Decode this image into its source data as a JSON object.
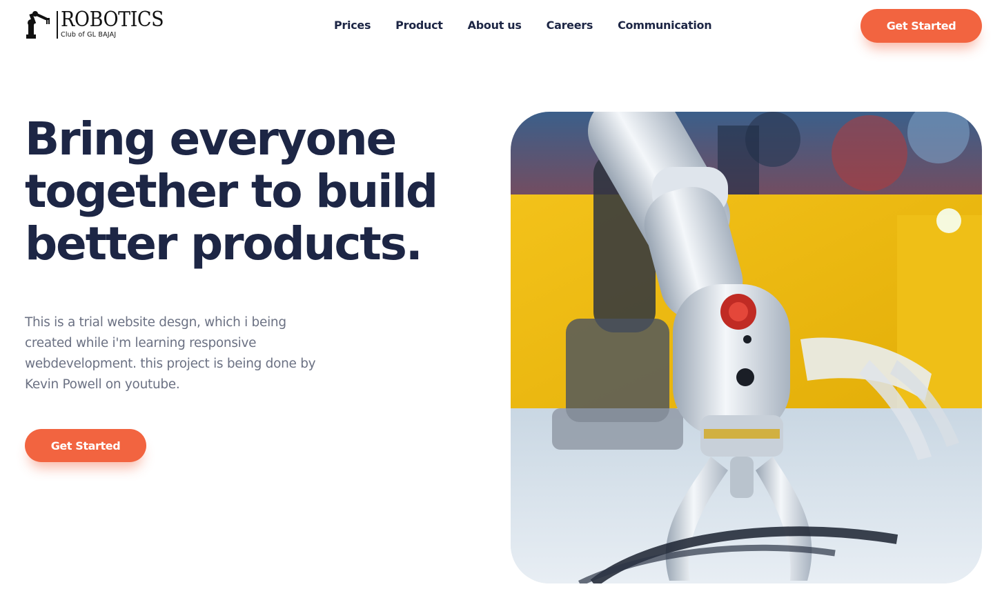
{
  "header": {
    "logo": {
      "title": "ROBOTICS",
      "subtitle": "Club of GL BAJAJ",
      "icon": "robot-arm-icon"
    },
    "nav": [
      {
        "label": "Prices"
      },
      {
        "label": "Product"
      },
      {
        "label": "About us"
      },
      {
        "label": "Careers"
      },
      {
        "label": "Communication"
      }
    ],
    "cta_label": "Get Started"
  },
  "hero": {
    "title": "Bring everyone together to build better products.",
    "description": "This is a trial website desgn, which i being created while i'm learning responsive webdevelopment. this project is being done by Kevin Powell on youtube.",
    "cta_label": "Get Started",
    "image": "robotic-arm-photo"
  },
  "colors": {
    "accent": "#f26440",
    "heading": "#1d2645",
    "body_text": "#6b7183",
    "background": "#ffffff"
  }
}
